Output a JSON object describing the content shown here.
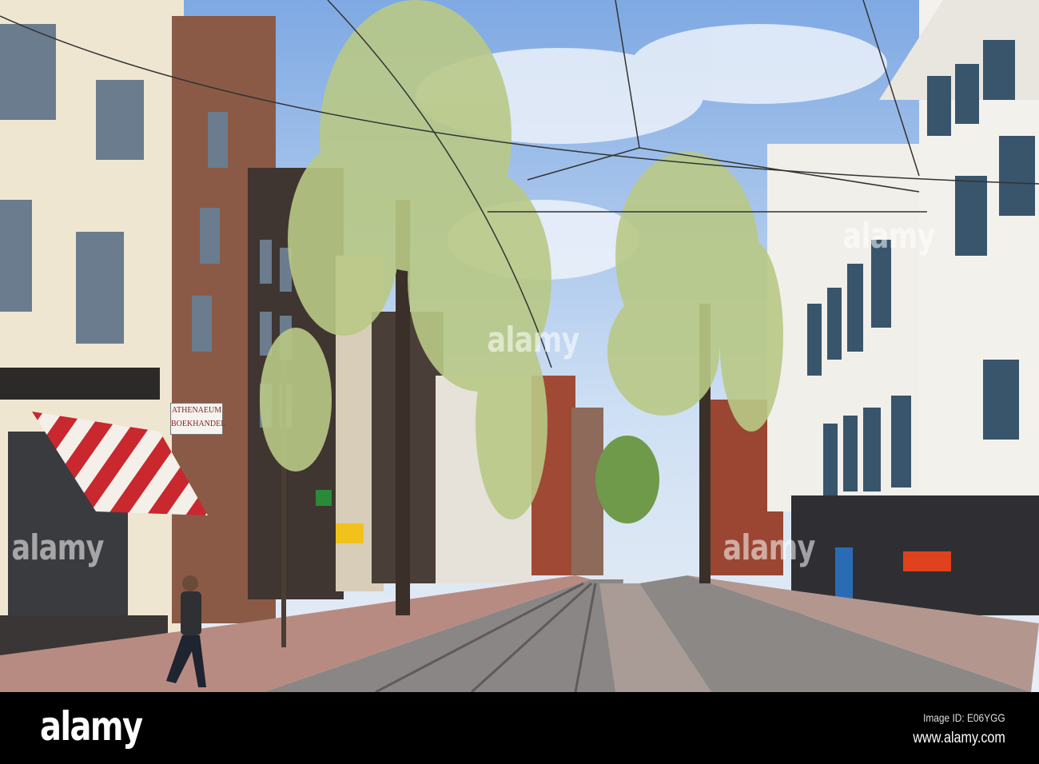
{
  "photo": {
    "description_label": "Street scene",
    "shop_sign": {
      "line1": "ATHENAEUM",
      "line2": "BOEKHANDEL"
    },
    "watermarks": [
      "alamy",
      "alamy",
      "alamy",
      "alamy"
    ]
  },
  "footer": {
    "logo": "alamy",
    "image_id": "Image ID: E06YGG",
    "website": "www.alamy.com"
  },
  "colors": {
    "sky": "#a9c8ee",
    "awning_red": "#c8282e",
    "foliage": "#b9c986"
  }
}
